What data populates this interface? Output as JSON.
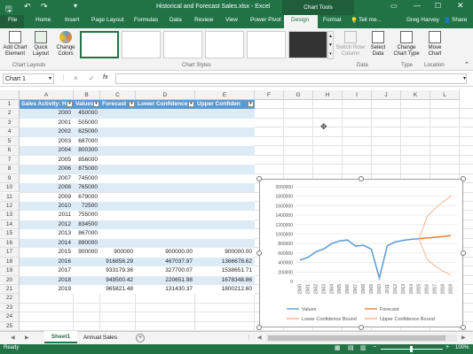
{
  "titlebar": {
    "title": "Historical and Forecast Sales.xlsx - Excel",
    "contextual": "Chart Tools",
    "user": "Greg Harvey",
    "share": "Share"
  },
  "tabs": [
    "File",
    "Home",
    "Insert",
    "Page Layout",
    "Formulas",
    "Data",
    "Review",
    "View",
    "Power Pivot",
    "Design",
    "Format"
  ],
  "tell_me": "Tell me...",
  "ribbon": {
    "add_chart_element": "Add Chart Element",
    "quick_layout": "Quick Layout",
    "change_colors": "Change Colors",
    "switch_row_column": "Switch Row/ Column",
    "select_data": "Select Data",
    "change_chart_type": "Change Chart Type",
    "move_chart": "Move Chart",
    "groups": {
      "chart_layouts": "Chart Layouts",
      "chart_styles": "Chart Styles",
      "data": "Data",
      "type": "Type",
      "location": "Location"
    }
  },
  "formula_bar": {
    "name_box": "Chart 1",
    "fx": "fx",
    "cancel": "×",
    "enter": "✓"
  },
  "columns": [
    "A",
    "B",
    "C",
    "D",
    "E",
    "F",
    "G",
    "H",
    "I",
    "J",
    "K",
    "L"
  ],
  "rows": [
    "1",
    "2",
    "3",
    "4",
    "5",
    "6",
    "7",
    "8",
    "9",
    "10",
    "11",
    "12",
    "13",
    "14",
    "15",
    "16",
    "17",
    "18",
    "19",
    "20",
    "21",
    "22",
    "23",
    "24",
    "25"
  ],
  "table": {
    "headers": [
      "Sales Activity: Historical",
      "Values",
      "Forecast",
      "Lower Confidence Bound",
      "Upper Confidence Bound"
    ],
    "header_display": [
      "Sales Activity: His",
      "Values",
      "Forecast",
      "Lower Confidence",
      "Upper Confiden"
    ],
    "data": [
      [
        "2000",
        "450000",
        "",
        "",
        ""
      ],
      [
        "2001",
        "505000",
        "",
        "",
        ""
      ],
      [
        "2002",
        "625000",
        "",
        "",
        ""
      ],
      [
        "2003",
        "687000",
        "",
        "",
        ""
      ],
      [
        "2004",
        "800300",
        "",
        "",
        ""
      ],
      [
        "2005",
        "856000",
        "",
        "",
        ""
      ],
      [
        "2006",
        "875000",
        "",
        "",
        ""
      ],
      [
        "2007",
        "745000",
        "",
        "",
        ""
      ],
      [
        "2008",
        "765000",
        "",
        "",
        ""
      ],
      [
        "2009",
        "679000",
        "",
        "",
        ""
      ],
      [
        "2010",
        "72500",
        "",
        "",
        ""
      ],
      [
        "2011",
        "755000",
        "",
        "",
        ""
      ],
      [
        "2012",
        "834500",
        "",
        "",
        ""
      ],
      [
        "2013",
        "867000",
        "",
        "",
        ""
      ],
      [
        "2014",
        "890000",
        "",
        "",
        ""
      ],
      [
        "2015",
        "900000",
        "900000",
        "900000.00",
        "900000.00"
      ],
      [
        "2016",
        "",
        "916858.29",
        "467037.97",
        "1366678.62"
      ],
      [
        "2017",
        "",
        "933179.36",
        "327700.07",
        "1538651.71"
      ],
      [
        "2018",
        "",
        "949500.42",
        "220651.98",
        "1678348.86"
      ],
      [
        "2019",
        "",
        "965821.48",
        "131430.37",
        "1800212.60"
      ]
    ]
  },
  "chart_data": {
    "type": "line",
    "x": [
      "2000",
      "2001",
      "2002",
      "2003",
      "2004",
      "2005",
      "2006",
      "2007",
      "2008",
      "2009",
      "2010",
      "2011",
      "2012",
      "2013",
      "2014",
      "2015",
      "2016",
      "2017",
      "2018",
      "2019"
    ],
    "ylim": [
      0,
      2000000
    ],
    "yticks": [
      "0",
      "200000",
      "400000",
      "600000",
      "800000",
      "1000000",
      "1200000",
      "1400000",
      "1600000",
      "1800000",
      "2000000"
    ],
    "series": [
      {
        "name": "Values",
        "color": "#5b9bd5",
        "values": [
          450000,
          505000,
          625000,
          687000,
          800300,
          856000,
          875000,
          745000,
          765000,
          679000,
          72500,
          755000,
          834500,
          867000,
          890000,
          900000,
          null,
          null,
          null,
          null
        ]
      },
      {
        "name": "Forecast",
        "color": "#ed7d31",
        "values": [
          null,
          null,
          null,
          null,
          null,
          null,
          null,
          null,
          null,
          null,
          null,
          null,
          null,
          null,
          null,
          900000,
          916858.29,
          933179.36,
          949500.42,
          965821.48
        ]
      },
      {
        "name": "Lower Confidence Bound",
        "color": "#f4b183",
        "values": [
          null,
          null,
          null,
          null,
          null,
          null,
          null,
          null,
          null,
          null,
          null,
          null,
          null,
          null,
          null,
          900000,
          467037.97,
          327700.07,
          220651.98,
          131430.37
        ]
      },
      {
        "name": "Upper Confidence Bound",
        "color": "#f4b183",
        "values": [
          null,
          null,
          null,
          null,
          null,
          null,
          null,
          null,
          null,
          null,
          null,
          null,
          null,
          null,
          null,
          900000,
          1366678.62,
          1538651.71,
          1678348.86,
          1800212.6
        ]
      }
    ]
  },
  "sheets": {
    "active": "Sheet1",
    "other": "Annual Sales",
    "add": "+"
  },
  "status": {
    "ready": "Ready",
    "zoom": "100%"
  }
}
